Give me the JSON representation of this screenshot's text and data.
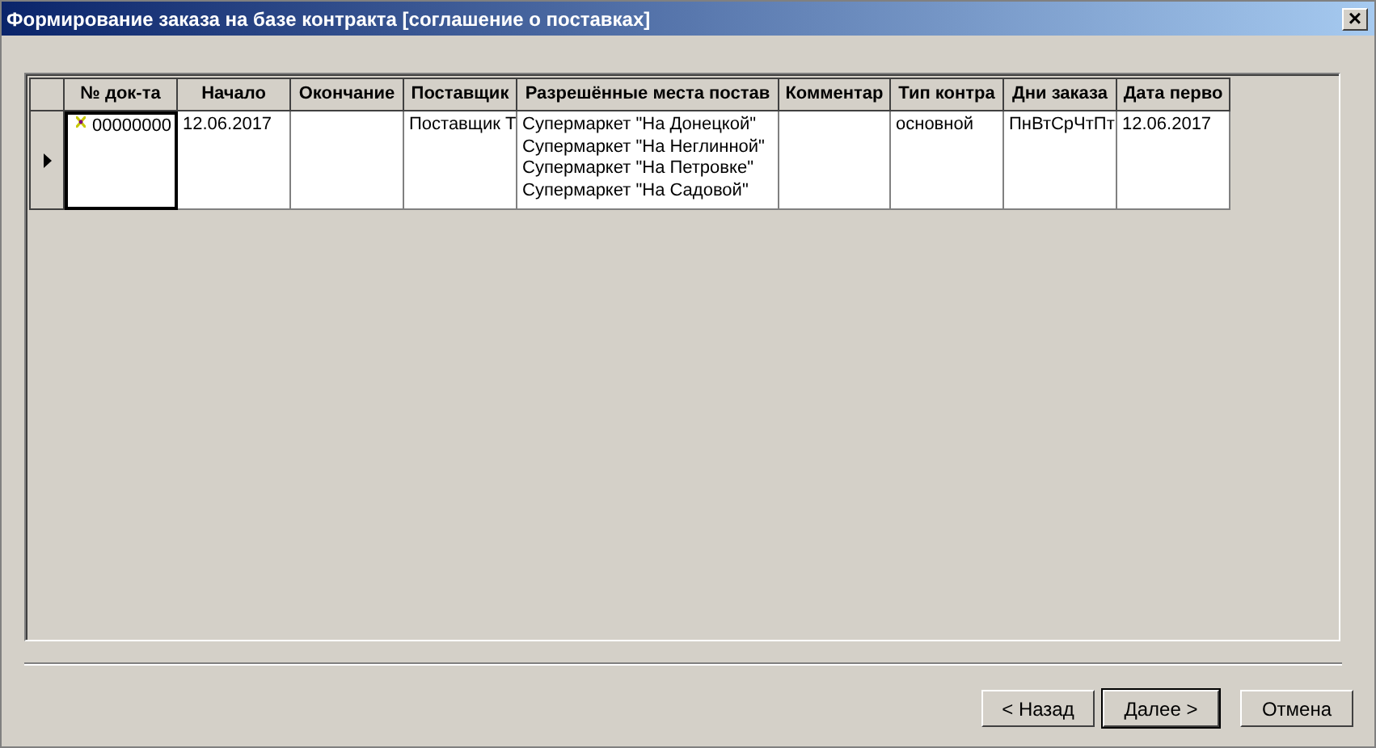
{
  "window": {
    "title": "Формирование заказа на базе контракта [соглашение о поставках]",
    "close": "×"
  },
  "table": {
    "columns": [
      "№ док-та",
      "Начало",
      "Окончание",
      "Поставщик",
      "Разрешённые места постав",
      "Комментар",
      "Тип контра",
      "Дни заказа",
      "Дата перво"
    ],
    "rows": [
      {
        "selected": true,
        "cells": [
          {
            "text": "00000000",
            "focused": true
          },
          {
            "text": "12.06.2017",
            "focused": false
          },
          {
            "text": "",
            "focused": false
          },
          {
            "text": "Поставщик Т",
            "focused": false
          },
          {
            "lines": [
              "Супермаркет \"На Донецкой\"",
              "Супермаркет \"На Неглинной\"",
              "Супермаркет \"На Петровке\"",
              "Супермаркет \"На Садовой\""
            ],
            "focused": false
          },
          {
            "text": "",
            "focused": false
          },
          {
            "text": "основной",
            "focused": false
          },
          {
            "text": "ПнВтСрЧтПт",
            "focused": false
          },
          {
            "text": "12.06.2017",
            "focused": false
          }
        ]
      }
    ]
  },
  "buttons": [
    {
      "label": "< Назад",
      "default": false
    },
    {
      "label": "Далее >",
      "default": true
    },
    {
      "label": "Отмена",
      "default": false
    }
  ]
}
